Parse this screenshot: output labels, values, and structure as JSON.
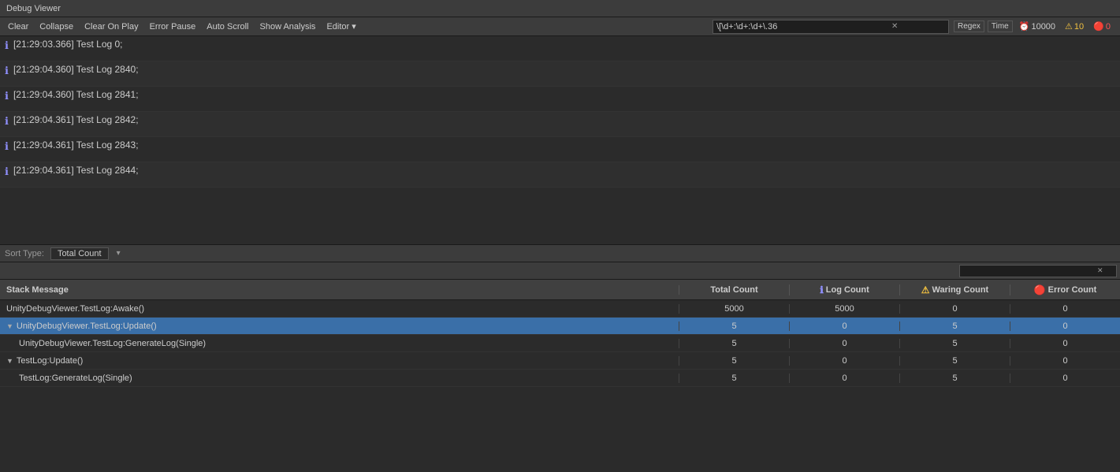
{
  "titleBar": {
    "text": "Debug Viewer"
  },
  "toolbar": {
    "clear": "Clear",
    "collapse": "Collapse",
    "clearOnPlay": "Clear On Play",
    "errorPause": "Error Pause",
    "autoScroll": "Auto Scroll",
    "showAnalysis": "Show Analysis",
    "editor": "Editor ▾",
    "searchValue": "\\[\\d+:\\d+:\\d+\\.36",
    "regex": "Regex",
    "time": "Time",
    "maxCount": "10000",
    "warnCount": "10",
    "errorCount": "0"
  },
  "logs": [
    {
      "icon": "ℹ",
      "text": "[21:29:03.366] Test Log 0;"
    },
    {
      "icon": "ℹ",
      "text": "[21:29:04.360] Test Log 2840;"
    },
    {
      "icon": "ℹ",
      "text": "[21:29:04.360] Test Log 2841;"
    },
    {
      "icon": "ℹ",
      "text": "[21:29:04.361] Test Log 2842;"
    },
    {
      "icon": "ℹ",
      "text": "[21:29:04.361] Test Log 2843;"
    },
    {
      "icon": "ℹ",
      "text": "[21:29:04.361] Test Log 2844;"
    }
  ],
  "analysis": {
    "sortLabel": "Sort Type:",
    "sortValue": "Total Count",
    "tableHeaders": {
      "stackMessage": "Stack Message",
      "totalCount": "Total Count",
      "logCount": "Log Count",
      "waringCount": "Waring Count",
      "errorCount": "Error Count"
    },
    "rows": [
      {
        "id": 0,
        "indent": 0,
        "expanded": false,
        "arrow": "",
        "name": "UnityDebugViewer.TestLog:Awake()",
        "totalCount": "5000",
        "logCount": "5000",
        "waringCount": "0",
        "errorCount": "0",
        "selected": false
      },
      {
        "id": 1,
        "indent": 0,
        "expanded": true,
        "arrow": "▼",
        "name": "UnityDebugViewer.TestLog:Update()",
        "totalCount": "5",
        "logCount": "0",
        "waringCount": "5",
        "errorCount": "0",
        "selected": true
      },
      {
        "id": 2,
        "indent": 1,
        "expanded": false,
        "arrow": "",
        "name": "UnityDebugViewer.TestLog:GenerateLog(Single)",
        "totalCount": "5",
        "logCount": "0",
        "waringCount": "5",
        "errorCount": "0",
        "selected": false
      },
      {
        "id": 3,
        "indent": 0,
        "expanded": true,
        "arrow": "▼",
        "name": "TestLog:Update()",
        "totalCount": "5",
        "logCount": "0",
        "waringCount": "5",
        "errorCount": "0",
        "selected": false
      },
      {
        "id": 4,
        "indent": 1,
        "expanded": false,
        "arrow": "",
        "name": "TestLog:GenerateLog(Single)",
        "totalCount": "5",
        "logCount": "0",
        "waringCount": "5",
        "errorCount": "0",
        "selected": false
      }
    ]
  }
}
